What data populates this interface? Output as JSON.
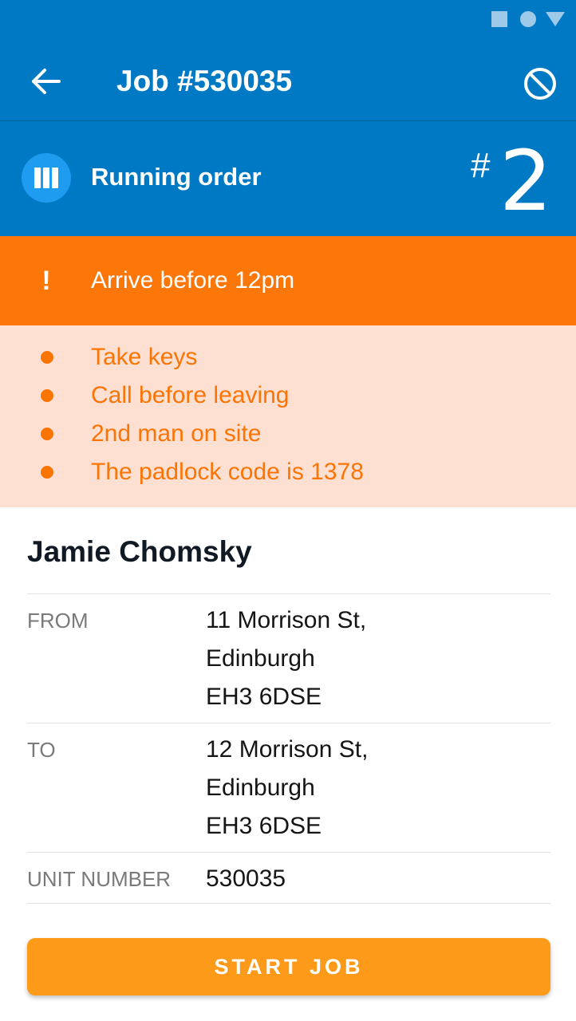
{
  "header": {
    "title": "Job #530035",
    "back_icon": "arrow-left-icon",
    "cancel_icon": "cancel-circle-icon",
    "background_color": "#0079c4"
  },
  "running_order": {
    "label": "Running order",
    "hash": "#",
    "number": "2",
    "icon": "running-order-icon"
  },
  "alert": {
    "icon_text": "!",
    "text": "Arrive before 12pm",
    "color": "#fc7608"
  },
  "notes": [
    "Take keys",
    "Call before leaving",
    "2nd man on site",
    "The padlock code is 1378"
  ],
  "customer": {
    "name": "Jamie Chomsky"
  },
  "details": {
    "from_label": "FROM",
    "from_lines": [
      "11 Morrison St,",
      "Edinburgh",
      "EH3 6DSE"
    ],
    "to_label": "TO",
    "to_lines": [
      "12 Morrison St,",
      "Edinburgh",
      "EH3 6DSE"
    ],
    "unit_label": "UNIT NUMBER",
    "unit_value": "530035"
  },
  "actions": {
    "start_label": "START JOB",
    "start_color": "#fd9a19"
  }
}
